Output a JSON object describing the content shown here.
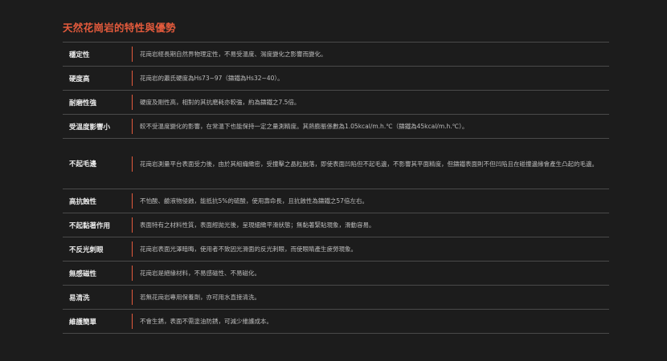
{
  "title": "天然花崗岩的特性與優勢",
  "rows": [
    {
      "label": "穩定性",
      "desc": "花崗岩經長期自然界物理定性，不易受溫度、濕度變化之影響而變化。"
    },
    {
      "label": "硬度高",
      "desc": "花崗岩的蕭氏硬度為Hs73~97（鑄鐵為Hs32~40）。"
    },
    {
      "label": "耐磨性強",
      "desc": "硬度及剛性高，相對的其抗磨耗亦較強，約為鑄鐵之7.5倍。"
    },
    {
      "label": "受溫度影響小",
      "desc": "較不受溫度變化的影響，在常溫下也能保持一定之量測精度。其熱膨脹係數為1.05kcal/m.h.℃（鑄鐵為45kcal/m.h.℃）。"
    },
    {
      "label": "不起毛邊",
      "desc": "花崗岩測量平台表面受力後，由於其組織緻密，受撞擊之晶粒脫落，即使表面凹陷但不起毛邊，不影響其平面精度，但鑄鐵表面則不但凹陷且在碰撞邊緣會產生凸起的毛邊。"
    },
    {
      "label": "高抗蝕性",
      "desc": "不怕酸、鹼液物侵蝕，能抵抗5%的硫酸，使用壽命長，且抗蝕性為鑄鐵之57倍左右。"
    },
    {
      "label": "不起黏著作用",
      "desc": "表面特有之材料性質，表面經拋光後，呈現細緻平滑狀態；無黏著緊貼現象，滑動容易。"
    },
    {
      "label": "不反光刺眼",
      "desc": "花崗岩表面光澤暗晦，使用者不致因光滑面的反光刺眼，而使眼睛產生疲勞現象。"
    },
    {
      "label": "無感磁性",
      "desc": "花崗岩是絕緣材料，不易感磁性、不易磁化。"
    },
    {
      "label": "易清洗",
      "desc": "若無花崗岩專用保養劑，亦可用水直接清洗。"
    },
    {
      "label": "維護簡單",
      "desc": "不會生銹，表面不需塗油防銹，可減少維護成本。"
    }
  ]
}
